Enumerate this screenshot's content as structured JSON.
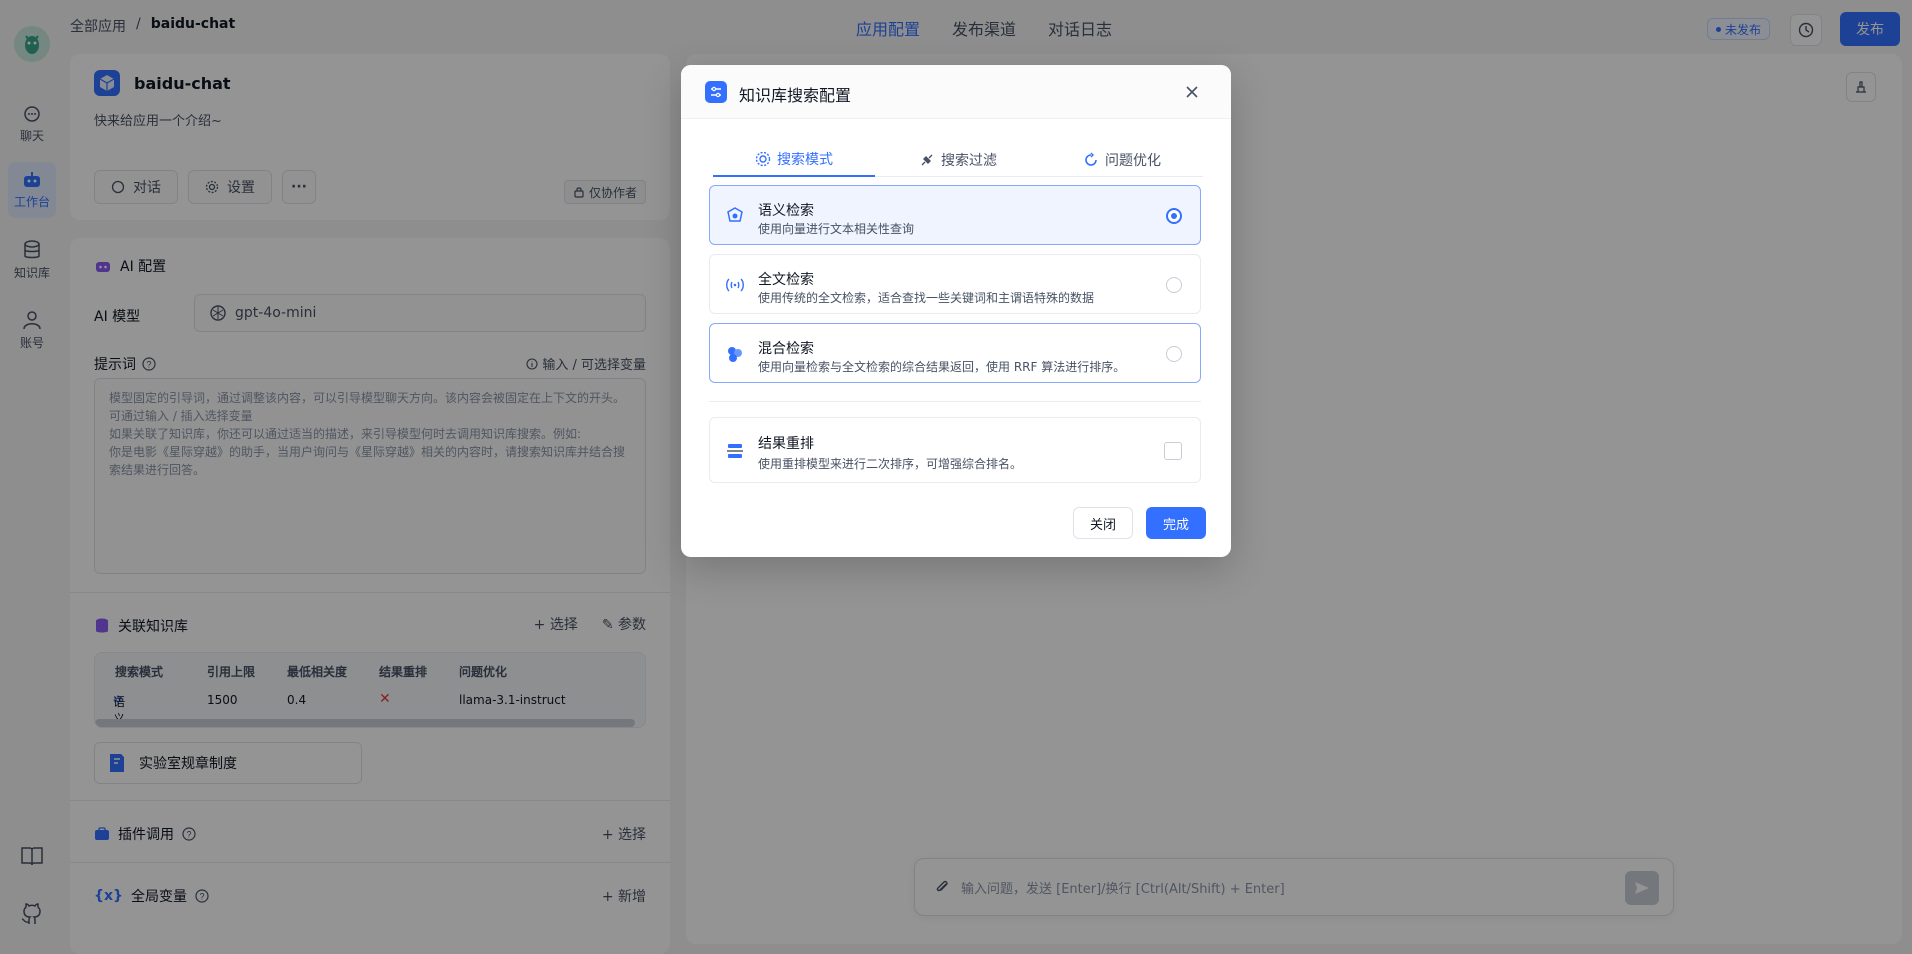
{
  "nav": {
    "items": [
      {
        "label": "聊天",
        "icon": "chat-icon"
      },
      {
        "label": "工作台",
        "icon": "robot-icon"
      },
      {
        "label": "知识库",
        "icon": "database-icon"
      },
      {
        "label": "账号",
        "icon": "user-icon"
      }
    ],
    "bottom_icons": [
      "book-icon",
      "github-icon"
    ]
  },
  "header": {
    "breadcrumb": {
      "root": "全部应用",
      "separator": "/",
      "current": "baidu-chat"
    },
    "tabs": [
      "应用配置",
      "发布渠道",
      "对话日志"
    ],
    "status_badge": "未发布",
    "publish_label": "发布"
  },
  "app": {
    "name": "baidu-chat",
    "intro": "快来给应用一个介绍~",
    "chat_button": "对话",
    "settings_button": "设置",
    "more_button": "···",
    "collab_tag": "仅协作者"
  },
  "ai_config": {
    "section_title": "AI 配置",
    "model_label": "AI 模型",
    "model_value": "gpt-4o-mini",
    "prompt_label": "提示词",
    "prompt_hint": "输入 / 可选择变量",
    "prompt_placeholder": "模型固定的引导词，通过调整该内容，可以引导模型聊天方向。该内容会被固定在上下文的开头。可通过输入 / 插入选择变量\n如果关联了知识库，你还可以通过适当的描述，来引导模型何时去调用知识库搜索。例如:\n你是电影《星际穿越》的助手，当用户询问与《星际穿越》相关的内容时，请搜索知识库并结合搜索结果进行回答。"
  },
  "knowledge": {
    "section_title": "关联知识库",
    "select_label": "选择",
    "params_label": "参数",
    "table_headers": [
      "搜索模式",
      "引用上限",
      "最低相关度",
      "结果重排",
      "问题优化"
    ],
    "table_row": {
      "mode": "语义检索",
      "limit": "1500",
      "min_relevance": "0.4",
      "rerank": "✕",
      "optimize": "llama-3.1-instruct"
    },
    "file_name": "实验室规章制度"
  },
  "plugins": {
    "section_title": "插件调用",
    "action": "选择"
  },
  "variables": {
    "section_title": "全局变量",
    "action": "新增"
  },
  "chat": {
    "input_placeholder": "输入问题，发送 [Enter]/换行 [Ctrl(Alt/Shift) + Enter]"
  },
  "modal": {
    "title": "知识库搜索配置",
    "tabs": [
      "搜索模式",
      "搜索过滤",
      "问题优化"
    ],
    "options": [
      {
        "title": "语义检索",
        "desc": "使用向量进行文本相关性查询",
        "selected": true
      },
      {
        "title": "全文检索",
        "desc": "使用传统的全文检索，适合查找一些关键词和主谓语特殊的数据",
        "selected": false
      },
      {
        "title": "混合检索",
        "desc": "使用向量检索与全文检索的综合结果返回，使用 RRF 算法进行排序。",
        "selected": false
      }
    ],
    "rerank": {
      "title": "结果重排",
      "desc": "使用重排模型来进行二次排序，可增强综合排名。"
    },
    "close_label": "关闭",
    "done_label": "完成"
  },
  "colors": {
    "accent": "#3370ff",
    "danger": "#e53935"
  }
}
